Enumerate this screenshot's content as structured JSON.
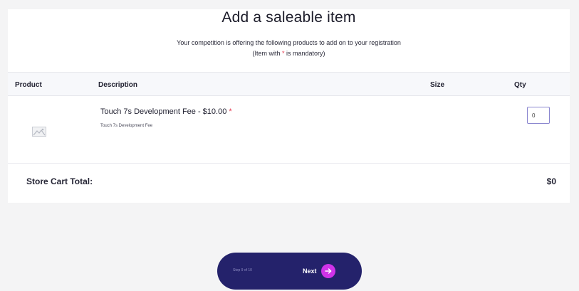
{
  "header": {
    "title": "Add a saleable item",
    "subtitle_line1": "Your competition is offering the following products to add on to your registration",
    "subtitle_line2_pre": "(Item with ",
    "subtitle_required_mark": "*",
    "subtitle_line2_post": " is mandatory)"
  },
  "table": {
    "columns": {
      "product": "Product",
      "description": "Description",
      "size": "Size",
      "qty": "Qty"
    },
    "rows": [
      {
        "title": "Touch 7s Development Fee - $10.00",
        "required_mark": "*",
        "description": "Touch 7s Development Fee",
        "image_icon": "image-placeholder-icon",
        "qty_value": "0"
      }
    ]
  },
  "totals": {
    "label": "Store Cart Total:",
    "value": "$0"
  },
  "footer": {
    "step_text": "Step 9 of 10",
    "next_label": "Next",
    "next_icon": "arrow-right-icon"
  },
  "colors": {
    "footer_bg": "#24226b",
    "next_icon_bg": "#cf33e8",
    "required": "#e5344a",
    "qty_border": "#8a86cf"
  }
}
